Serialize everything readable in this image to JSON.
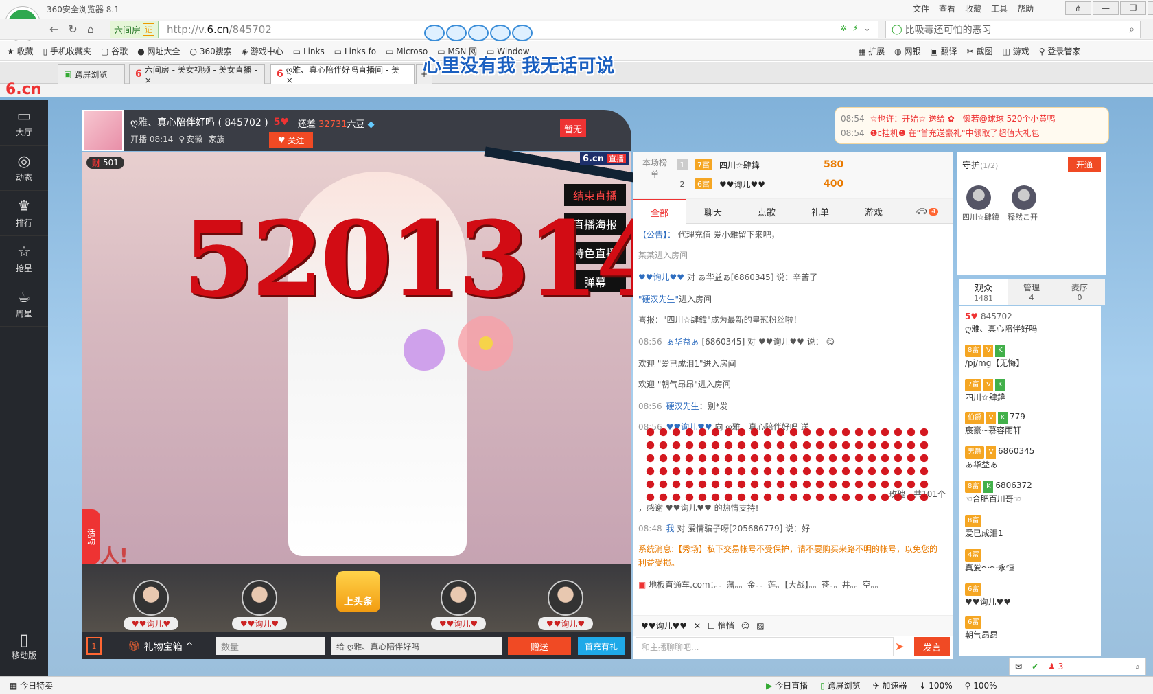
{
  "browser": {
    "app_title": "360安全浏览器 8.1",
    "logo_glyph": "e",
    "menu": [
      "文件",
      "查看",
      "收藏",
      "工具",
      "帮助"
    ],
    "window_buttons": [
      "⋔",
      "—",
      "❐",
      "✕"
    ],
    "site_chip": "六间房",
    "site_chip_badge": "证",
    "url_prefix": "http://v.",
    "url_domain": "6.cn",
    "url_path": "/845702",
    "search_placeholder": "比吸毒还可怕的恶习",
    "bookmarks": [
      "收藏",
      "手机收藏夹",
      "谷歌",
      "网址大全",
      "360搜索",
      "游戏中心",
      "Links",
      "Links fo",
      "Microso",
      "MSN 网",
      "Window"
    ],
    "tools": [
      "扩展",
      "网银",
      "翻译",
      "截图",
      "游戏",
      "登录管家"
    ],
    "tabs": [
      {
        "label": "跨屏浏览"
      },
      {
        "label": "六间房 - 美女视频 - 美女直播 - ×"
      },
      {
        "label": "ღ雅、真心陪伴好吗直播间 - 美 ×"
      }
    ],
    "new_tab": "+",
    "overlay_text": "心里没有我  我无话可说"
  },
  "site": {
    "logo": "6.cn",
    "left_nav": [
      {
        "icon": "▭",
        "label": "大厅"
      },
      {
        "icon": "◎",
        "label": "动态"
      },
      {
        "icon": "♛",
        "label": "排行"
      },
      {
        "icon": "☆",
        "label": "抢星"
      },
      {
        "icon": "☕",
        "label": "周星"
      }
    ],
    "mobile_label": "移动版",
    "mobile_icon": "▯"
  },
  "anchor": {
    "name": "ღ雅、真心陪伴好吗 ( 845702 )",
    "level": "5",
    "diff_prefix": "还差",
    "diff_value": "32731",
    "diff_suffix": "六豆",
    "start_time": "开播 08:14",
    "location": "安徽",
    "family": "家族",
    "follow_label": "关注",
    "flag_label": "暂无"
  },
  "video": {
    "wealth_icon": "财",
    "wealth_value": "501",
    "brand": "6.cn",
    "brand_badge": "直播",
    "buttons": [
      "结束直播",
      "直播海报",
      "特色直播",
      "弹幕"
    ],
    "rose_text": "5201314",
    "activity_label": "活动",
    "caption": "人!"
  },
  "gift_strip": {
    "slots": [
      "♥♥询儿♥",
      "♥♥询儿♥",
      "♥♥询儿♥",
      "♥♥询儿♥"
    ],
    "headline_button": "上头条"
  },
  "controls": {
    "giftbox_badge": "1",
    "giftbox_label": "礼物宝箱",
    "qty_placeholder": "数量",
    "recipient": "给  ღ雅、真心陪伴好吗",
    "send_gift": "赠送",
    "first_recharge": "首充有礼"
  },
  "news": [
    {
      "time": "08:54",
      "text": "☆也许：开始☆ 送给 ✿ - 懒若@球球 520个小黄鸭"
    },
    {
      "time": "08:54",
      "text": "❶c挂机❶ 在\"首充送豪礼\"中领取了超值大礼包"
    }
  ],
  "rank": {
    "label": "本场榜单",
    "rows": [
      {
        "no": "1",
        "lv": "7富",
        "name": "四川☆肆鍏",
        "score": "580"
      },
      {
        "no": "2",
        "lv": "6富",
        "name": "♥♥询儿♥♥",
        "score": "400"
      }
    ]
  },
  "chat_tabs": [
    "全部",
    "聊天",
    "点歌",
    "礼单",
    "游戏"
  ],
  "chat_badge": "4",
  "chat": [
    {
      "time": "",
      "name": "【公告】：",
      "text": "代理充值  爱小雅留下来吧，"
    },
    {
      "time": "",
      "name": "",
      "text": "某某进入房间"
    },
    {
      "time": "",
      "name": "♥♥询儿♥♥",
      "text": "对 ぁ华益ぁ[6860345] 说：辛苦了"
    },
    {
      "time": "",
      "name": "\"硬汉先生\"",
      "text": "进入房间"
    },
    {
      "time": "",
      "name": "",
      "text": "喜报：\"四川☆肆鍏\"成为最新的皇冠粉丝啦！"
    },
    {
      "time": "08:56",
      "name": "ぁ华益ぁ",
      "text": "[6860345] 对 ♥♥询儿♥♥ 说："
    },
    {
      "time": "",
      "name": "",
      "text": "欢迎 \"爱已成泪1\"进入房间"
    },
    {
      "time": "",
      "name": "",
      "text": "欢迎 \"朝气昂昂\"进入房间"
    },
    {
      "time": "08:56",
      "name": "硬汉先生",
      "text": "：别*发"
    },
    {
      "time": "08:56",
      "name": "♥♥询儿♥♥",
      "text": "向 ღ雅、真心陪伴好吗 送"
    },
    {
      "time": "",
      "name": "",
      "text": "玫瑰，共101个"
    },
    {
      "time": "",
      "name": "",
      "text": "，感谢 ♥♥询儿♥♥ 的热情支持!"
    },
    {
      "time": "08:48",
      "name": "我",
      "text": "对 爱情骗子呀[205686779] 说：好"
    },
    {
      "time": "",
      "name": "",
      "text": "系统消息:【秀场】私下交易帐号不受保护，请不要购买来路不明的帐号，以免您的利益受损。"
    },
    {
      "time": "",
      "name": "",
      "text": "地板直通车.com：。。藩。。金。。莲。【大战】。。苍。。井。。空。。"
    }
  ],
  "chat_input": {
    "target": "♥♥询儿♥♥",
    "whisper": "悄悄",
    "placeholder": "和主播聊聊吧...",
    "send": "发言"
  },
  "guard": {
    "title": "守护",
    "count": "(1/2)",
    "open": "开通",
    "members": [
      "四川☆肆鍏",
      "释然こ开"
    ]
  },
  "audience_tabs": [
    {
      "label": "观众",
      "count": "1481"
    },
    {
      "label": "管理",
      "count": "4"
    },
    {
      "label": "麦序",
      "count": "0"
    }
  ],
  "audience": [
    {
      "lv": "5♥",
      "id": "845702",
      "name": "ღ雅、真心陪伴好吗"
    },
    {
      "lv": "8富",
      "id": "",
      "name": "/pj/mg【无悔】"
    },
    {
      "lv": "7富",
      "id": "",
      "name": "四川☆肆鍏"
    },
    {
      "lv": "伯爵",
      "id": "779",
      "name": "宸豪~慕容雨轩"
    },
    {
      "lv": "男爵",
      "id": "6860345",
      "name": "ぁ华益ぁ"
    },
    {
      "lv": "8富",
      "id": "6806372",
      "name": "☜合肥百川哥☜"
    },
    {
      "lv": "8富",
      "id": "",
      "name": "爱已成泪1"
    },
    {
      "lv": "4富",
      "id": "",
      "name": "真爱～～永恒"
    },
    {
      "lv": "6富",
      "id": "",
      "name": "♥♥询儿♥♥"
    },
    {
      "lv": "6富",
      "id": "",
      "name": "朝气昂昂"
    }
  ],
  "status": {
    "left": "今日特卖",
    "right": [
      "今日直播",
      "跨屏浏览",
      "加速器",
      "100%",
      "100%"
    ],
    "float_count": "3"
  }
}
